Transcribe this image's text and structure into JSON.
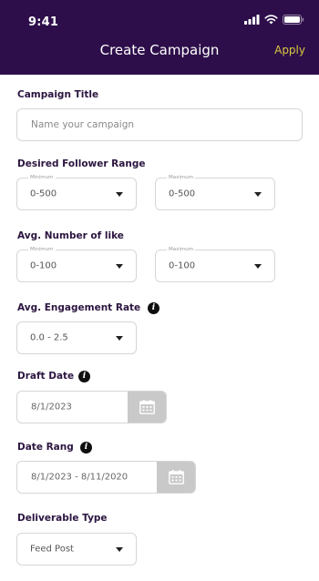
{
  "status_bar": {
    "time": "9:41"
  },
  "header": {
    "title": "Create Campaign",
    "apply_label": "Apply"
  },
  "campaign_title": {
    "label": "Campaign Title",
    "placeholder": "Name your campaign"
  },
  "follower_range": {
    "label": "Desired Follower Range",
    "minimum": {
      "legend": "Minimum",
      "value": "0-500"
    },
    "maximum": {
      "legend": "Maximum",
      "value": "0-500"
    }
  },
  "avg_likes": {
    "label": "Avg. Number of like",
    "minimum": {
      "legend": "Minimum",
      "value": "0-100"
    },
    "maximum": {
      "legend": "Maximum",
      "value": "0-100"
    }
  },
  "engagement_rate": {
    "label": "Avg. Engagement Rate",
    "value": "0.0 - 2.5"
  },
  "draft_date": {
    "label": "Draft Date",
    "value": "8/1/2023"
  },
  "date_range": {
    "label": "Date Rang",
    "value": "8/1/2023 - 8/11/2020"
  },
  "deliverable_type": {
    "label": "Deliverable Type",
    "value": "Feed Post"
  },
  "colors": {
    "header_bg": "#2d0e4a",
    "apply": "#d9c840",
    "calendar_button": "#c9c9c9"
  }
}
